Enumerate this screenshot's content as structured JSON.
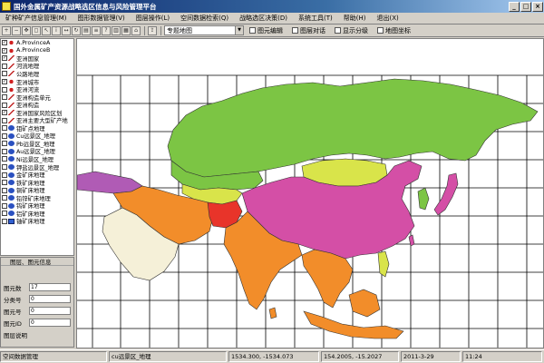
{
  "window": {
    "title": "国外金属矿产资源战略选区信息与风险管理平台",
    "minimize": "_",
    "maximize": "□",
    "close": "×"
  },
  "menu": [
    "矿种矿产信息管理(M)",
    "图形数据管理(V)",
    "图层操作(L)",
    "空间数据检索(Q)",
    "战略选区决策(D)",
    "系统工具(T)",
    "帮助(H)",
    "退出(X)"
  ],
  "toolbar": {
    "buttons": [
      "zoom-in",
      "zoom-out",
      "pan",
      "full-extent",
      "select",
      "identify",
      "measure",
      "refresh",
      "print",
      "layers",
      "query",
      "stats",
      "legend",
      "home",
      "export"
    ],
    "topic_select_value": "专题地图",
    "checks": [
      "图元编辑",
      "图层对话",
      "显示分级",
      "地图坐标"
    ]
  },
  "layers": [
    {
      "checked": true,
      "icon": "pt",
      "label": "A.ProvinceA"
    },
    {
      "checked": true,
      "icon": "pt",
      "label": "A.ProvinceB"
    },
    {
      "checked": true,
      "icon": "ln",
      "label": "亚洲国家"
    },
    {
      "checked": false,
      "icon": "ln",
      "label": "河流地理"
    },
    {
      "checked": false,
      "icon": "ln",
      "label": "公路地理"
    },
    {
      "checked": true,
      "icon": "pt",
      "label": "亚洲城市"
    },
    {
      "checked": false,
      "icon": "pt",
      "label": "亚洲河流"
    },
    {
      "checked": false,
      "icon": "ln",
      "label": "亚洲构造单元"
    },
    {
      "checked": false,
      "icon": "ln",
      "label": "亚洲构造"
    },
    {
      "checked": true,
      "icon": "ln",
      "label": "亚洲国家风险区划"
    },
    {
      "checked": false,
      "icon": "ln",
      "label": "亚洲主要大型矿产地"
    },
    {
      "checked": false,
      "icon": "pg",
      "label": "钼矿点地理"
    },
    {
      "checked": false,
      "icon": "pg",
      "label": "Cu远景区_地理"
    },
    {
      "checked": false,
      "icon": "pg",
      "label": "Pb远景区_地理"
    },
    {
      "checked": false,
      "icon": "pg",
      "label": "Au远景区_地理"
    },
    {
      "checked": false,
      "icon": "pg",
      "label": "Ni远景区_地理"
    },
    {
      "checked": false,
      "icon": "pg",
      "label": "钾盐远景区_地理"
    },
    {
      "checked": false,
      "icon": "pg",
      "label": "金矿床地理"
    },
    {
      "checked": false,
      "icon": "pg",
      "label": "铁矿床地理"
    },
    {
      "checked": false,
      "icon": "pg",
      "label": "铜矿床地理"
    },
    {
      "checked": false,
      "icon": "pg",
      "label": "铅锌矿床地理"
    },
    {
      "checked": false,
      "icon": "pg",
      "label": "钨矿床地理"
    },
    {
      "checked": false,
      "icon": "pg",
      "label": "铝矿床地理"
    },
    {
      "checked": false,
      "icon": "rs",
      "label": "铀矿床地理"
    }
  ],
  "props": {
    "header": "图层、图元信息",
    "fields": [
      {
        "label": "图元数",
        "value": "17"
      },
      {
        "label": "分类号",
        "value": "0"
      },
      {
        "label": "图元号",
        "value": "0"
      },
      {
        "label": "图元ID",
        "value": "0"
      }
    ],
    "footer": "图层说明"
  },
  "status": [
    "空间数据管理",
    "cu远景区_地理",
    "1534.300, -1534.073",
    "154.2005, -15.2027",
    "2011-3-29",
    "11:24"
  ],
  "colors": {
    "green": "#7cc544",
    "magenta": "#d44fa6",
    "orange": "#f28d2a",
    "yellow": "#d9e44a",
    "red": "#e8342a",
    "cream": "#f5f0d8",
    "purple": "#b05bb5"
  }
}
